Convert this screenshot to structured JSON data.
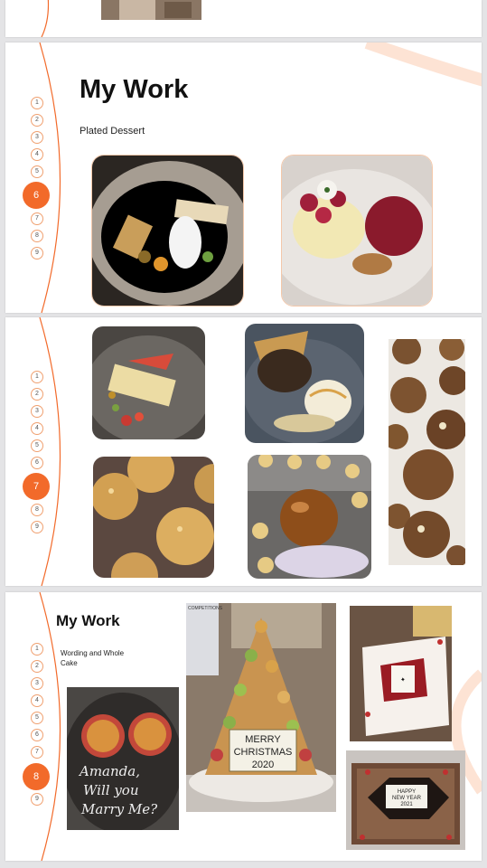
{
  "slides": [
    {
      "id": 6,
      "title": "My Work",
      "subtitle": "Plated Dessert",
      "nav": [
        "1",
        "2",
        "3",
        "4",
        "5",
        "6",
        "7",
        "8",
        "9"
      ],
      "active": "6"
    },
    {
      "id": 7,
      "nav": [
        "1",
        "2",
        "3",
        "4",
        "5",
        "6",
        "7",
        "8",
        "9"
      ],
      "active": "7"
    },
    {
      "id": 8,
      "title": "My Work",
      "subtitle": "Wording and Whole Cake",
      "nav": [
        "1",
        "2",
        "3",
        "4",
        "5",
        "6",
        "7",
        "8",
        "9"
      ],
      "active": "8"
    }
  ],
  "photos": {
    "proposal_plate_text": [
      "Amanda,",
      "Will you",
      "Marry Me?"
    ],
    "christmas_plaque_text": [
      "MERRY",
      "CHRISTMAS",
      "2020"
    ],
    "new_year_plaque_text": [
      "HAPPY",
      "NEW YEAR",
      "2021"
    ],
    "poster_heading": "COMPETITIONS"
  },
  "colors": {
    "accent": "#f26a2a",
    "accent_light": "#fde3d4",
    "background": "#e4e4e6"
  }
}
